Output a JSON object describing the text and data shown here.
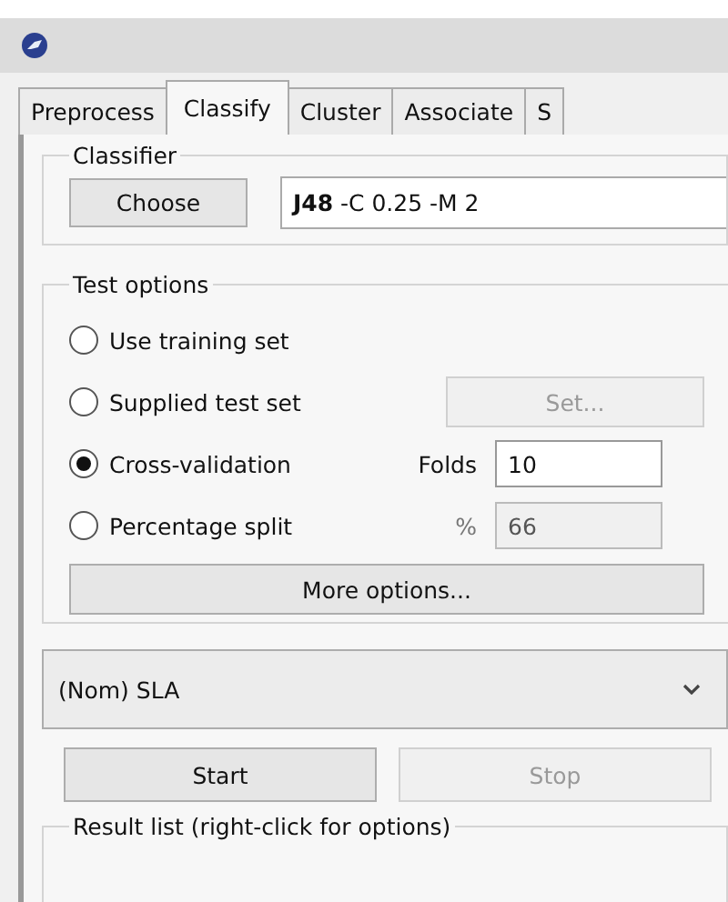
{
  "tabs": [
    {
      "label": "Preprocess",
      "selected": false
    },
    {
      "label": "Classify",
      "selected": true
    },
    {
      "label": "Cluster",
      "selected": false
    },
    {
      "label": "Associate",
      "selected": false
    },
    {
      "label": "S",
      "selected": false
    }
  ],
  "classifier": {
    "legend": "Classifier",
    "button": "Choose",
    "value": "**J48** -C 0.25 -M 2"
  },
  "test_options": {
    "legend": "Test options",
    "options": [
      {
        "label": "Use training set",
        "selected": false,
        "kind": "plain"
      },
      {
        "label": "Supplied test set",
        "selected": false,
        "kind": "button",
        "control": "Set...",
        "disabled": true
      },
      {
        "label": "Cross-validation",
        "selected": true,
        "kind": "field",
        "field_label": "Folds",
        "value": "10",
        "disabled": false
      },
      {
        "label": "Percentage split",
        "selected": false,
        "kind": "field",
        "field_label": "%",
        "value": "66",
        "disabled": true
      }
    ],
    "more_button": "More options..."
  },
  "class_dropdown": {
    "value": "(Nom) SLA"
  },
  "actions": [
    {
      "label": "Start",
      "disabled": false
    },
    {
      "label": "Stop",
      "disabled": true
    }
  ],
  "result_list": {
    "legend": "Result list (right-click for options)"
  }
}
